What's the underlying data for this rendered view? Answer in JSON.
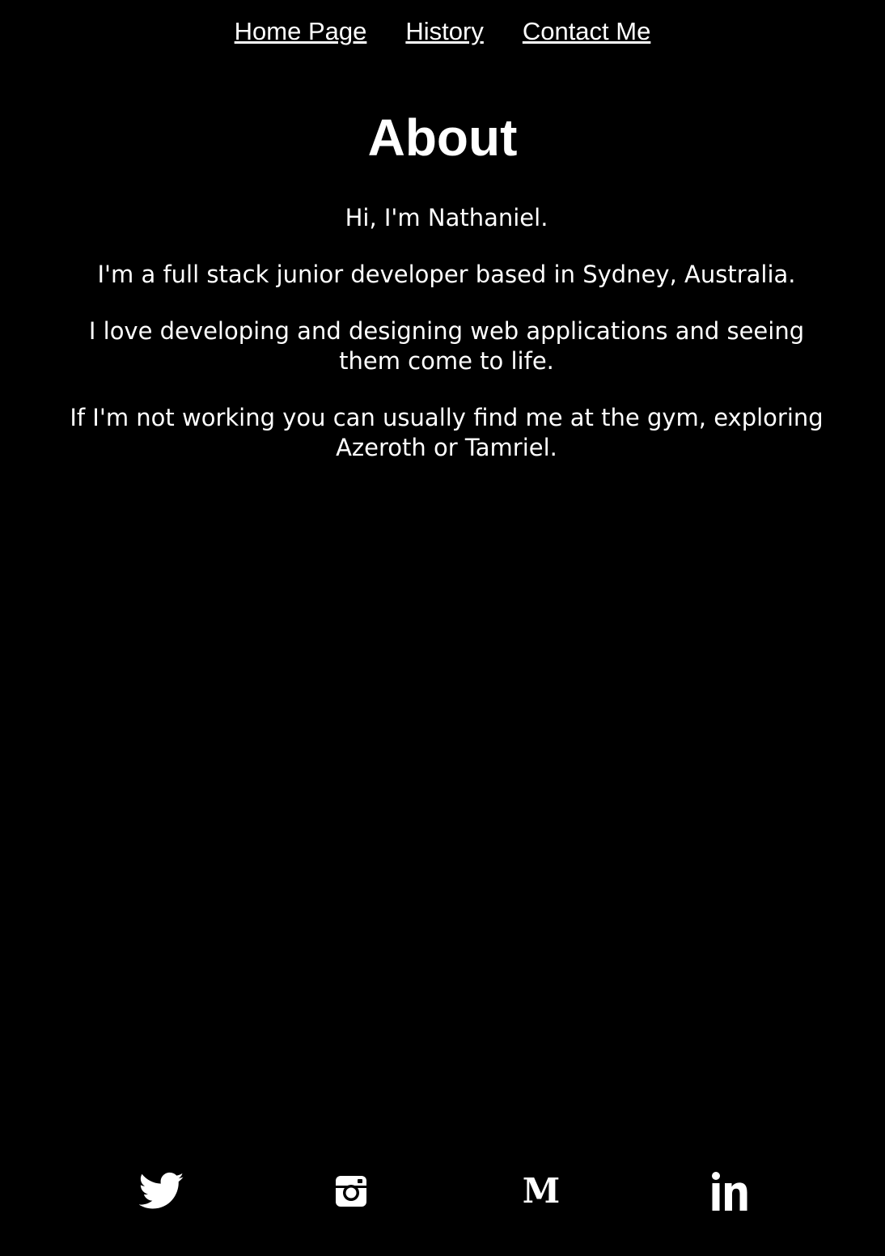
{
  "nav": {
    "items": [
      {
        "label": "Home Page"
      },
      {
        "label": "History"
      },
      {
        "label": "Contact Me"
      }
    ]
  },
  "main": {
    "title": "About",
    "paragraphs": [
      "Hi, I'm Nathaniel.",
      "I'm a full stack junior developer based in Sydney, Australia.",
      "I love developing and designing web applications and seeing them come to life.",
      "If I'm not working you can usually find me at the gym, exploring Azeroth or Tamriel."
    ]
  },
  "footer": {
    "social": [
      {
        "icon": "twitter-icon"
      },
      {
        "icon": "instagram-icon"
      },
      {
        "icon": "medium-icon",
        "glyph": "M"
      },
      {
        "icon": "linkedin-icon"
      }
    ]
  },
  "colors": {
    "background": "#000000",
    "text": "#ffffff"
  }
}
